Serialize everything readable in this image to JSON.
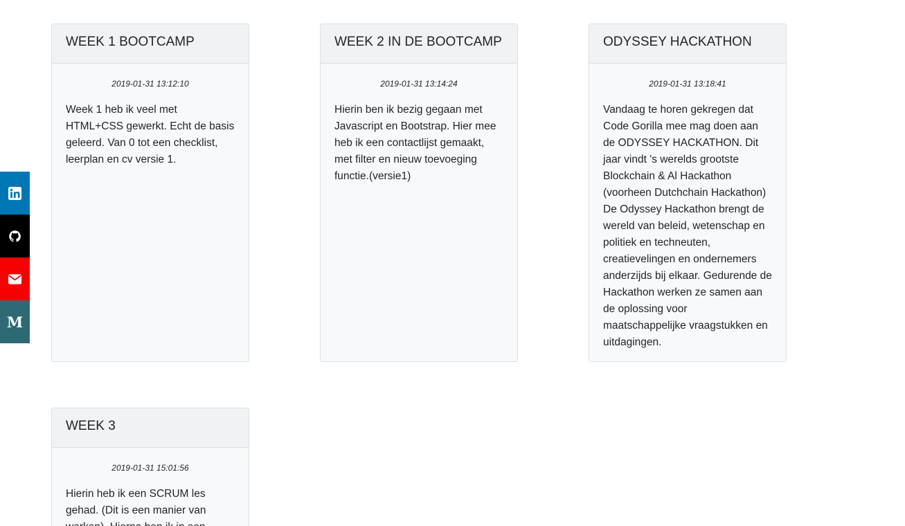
{
  "social": [
    {
      "name": "linkedin",
      "icon": "linkedin-icon",
      "color": "#0077b5"
    },
    {
      "name": "github",
      "icon": "github-icon",
      "color": "#000000"
    },
    {
      "name": "email",
      "icon": "envelope-icon",
      "color": "#f70000"
    },
    {
      "name": "medium",
      "icon": "medium-icon",
      "glyph": "M",
      "color": "#2e6a73"
    }
  ],
  "posts": [
    {
      "title": "WEEK 1 BOOTCAMP",
      "date": "2019-01-31 13:12:10",
      "text": "Week 1 heb ik veel met HTML+CSS gewerkt. Echt de basis geleerd. Van 0 tot een checklist, leerplan en cv versie 1."
    },
    {
      "title": "WEEK 2 IN DE BOOTCAMP",
      "date": "2019-01-31 13:14:24",
      "text": "Hierin ben ik bezig gegaan met Javascript en Bootstrap. Hier mee heb ik een contactlijst gemaakt, met filter en nieuw toevoeging functie.(versie1)"
    },
    {
      "title": "ODYSSEY HACKATHON",
      "date": "2019-01-31 13:18:41",
      "text": "Vandaag te horen gekregen dat Code Gorilla mee mag doen aan de ODYSSEY HACKATHON. Dit jaar vindt 's werelds grootste Blockchain & Al Hackathon (voorheen Dutchchain Hackathon) De Odyssey Hackathon brengt de wereld van beleid, wetenschap en politiek en techneuten, creatievelingen en ondernemers anderzijds bij elkaar. Gedurende de Hackathon werken ze samen aan de oplossing voor maatschappelijke vraagstukken en uitdagingen."
    },
    {
      "title": "WEEK 3",
      "date": "2019-01-31 15:01:56",
      "text": "Hierin heb ik een SCRUM les gehad. (Dit is een manier van werken). Hierna ben ik in een"
    }
  ]
}
